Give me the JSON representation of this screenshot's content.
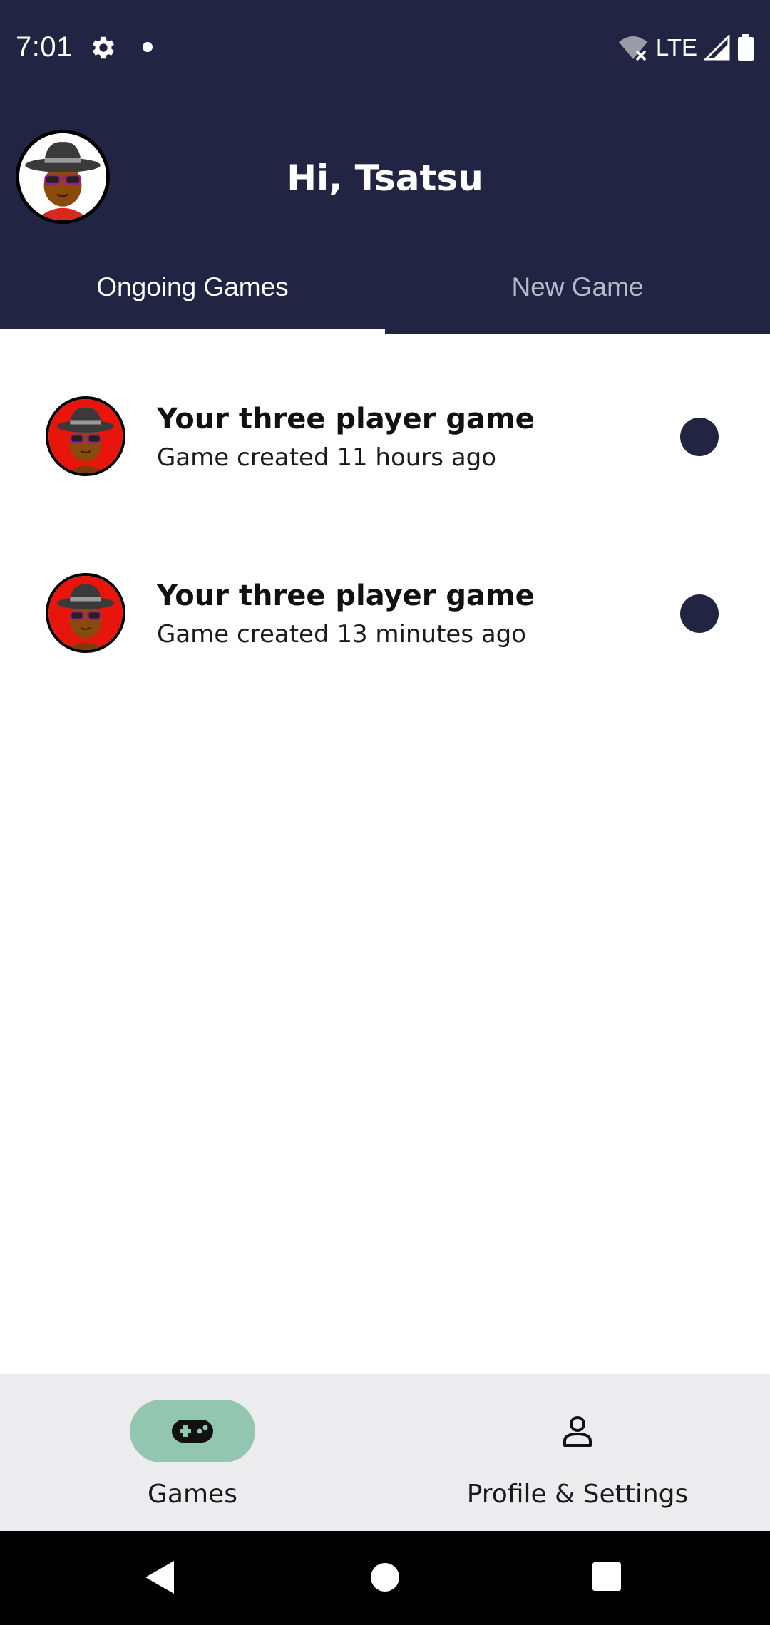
{
  "status_bar": {
    "time": "7:01",
    "network": "LTE"
  },
  "header": {
    "greeting": "Hi, Tsatsu",
    "tabs": [
      {
        "label": "Ongoing Games",
        "active": true
      },
      {
        "label": "New Game",
        "active": false
      }
    ]
  },
  "games": [
    {
      "title": "Your three player game",
      "subtitle": "Game created 11 hours ago"
    },
    {
      "title": "Your three player game",
      "subtitle": "Game created 13 minutes ago"
    }
  ],
  "bottom_nav": {
    "items": [
      {
        "label": "Games",
        "icon": "gamepad-icon",
        "active": true
      },
      {
        "label": "Profile & Settings",
        "icon": "person-icon",
        "active": false
      }
    ]
  },
  "colors": {
    "header_bg": "#212543",
    "accent_pill": "#93c6b1",
    "nav_bg": "#ececee",
    "avatar_ring_red": "#e8150d"
  }
}
